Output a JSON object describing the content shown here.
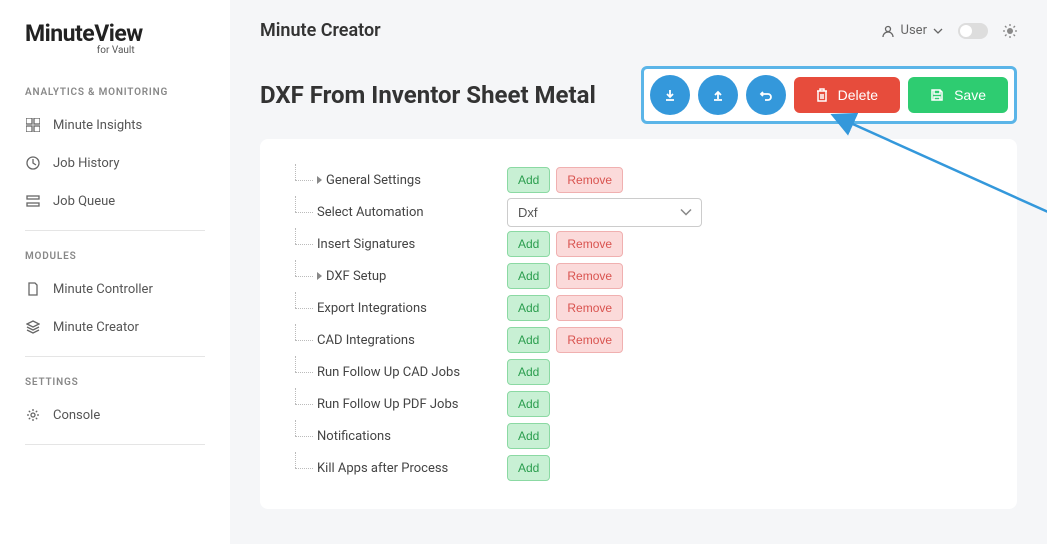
{
  "logo": {
    "main": "MinuteView",
    "sub": "for Vault"
  },
  "sidebar": {
    "sections": [
      {
        "label": "ANALYTICS & MONITORING",
        "items": [
          "Minute Insights",
          "Job History",
          "Job Queue"
        ]
      },
      {
        "label": "MODULES",
        "items": [
          "Minute Controller",
          "Minute Creator"
        ]
      },
      {
        "label": "SETTINGS",
        "items": [
          "Console"
        ]
      }
    ]
  },
  "topbar": {
    "title": "Minute Creator",
    "user": "User"
  },
  "page": {
    "title": "DXF From Inventor Sheet Metal"
  },
  "actions": {
    "delete": "Delete",
    "save": "Save"
  },
  "buttons": {
    "add": "Add",
    "remove": "Remove"
  },
  "automation": {
    "selected": "Dxf"
  },
  "tree": [
    {
      "label": "General Settings",
      "add": true,
      "remove": true,
      "caret": true
    },
    {
      "label": "Select Automation",
      "select": true
    },
    {
      "label": "Insert Signatures",
      "add": true,
      "remove": true
    },
    {
      "label": "DXF Setup",
      "add": true,
      "remove": true,
      "caret": true
    },
    {
      "label": "Export Integrations",
      "add": true,
      "remove": true
    },
    {
      "label": "CAD Integrations",
      "add": true,
      "remove": true
    },
    {
      "label": "Run Follow Up CAD Jobs",
      "add": true
    },
    {
      "label": "Run Follow Up PDF Jobs",
      "add": true
    },
    {
      "label": "Notifications",
      "add": true
    },
    {
      "label": "Kill Apps after Process",
      "add": true
    }
  ]
}
